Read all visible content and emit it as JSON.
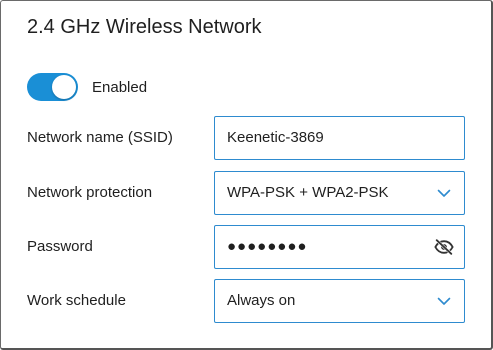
{
  "title": "2.4 GHz Wireless Network",
  "toggle": {
    "state": "on",
    "label": "Enabled",
    "color": "#1a8fd6"
  },
  "fields": {
    "ssid": {
      "label": "Network name (SSID)",
      "value": "Keenetic-3869"
    },
    "protection": {
      "label": "Network protection",
      "value": "WPA-PSK + WPA2-PSK",
      "icon": "chevron-down-icon"
    },
    "password": {
      "label": "Password",
      "value": "●●●●●●●●",
      "icon": "eye-off-icon"
    },
    "schedule": {
      "label": "Work schedule",
      "value": "Always on",
      "icon": "chevron-down-icon"
    }
  },
  "colors": {
    "accent": "#1a8fd6",
    "field_border": "#2e8bcf"
  }
}
